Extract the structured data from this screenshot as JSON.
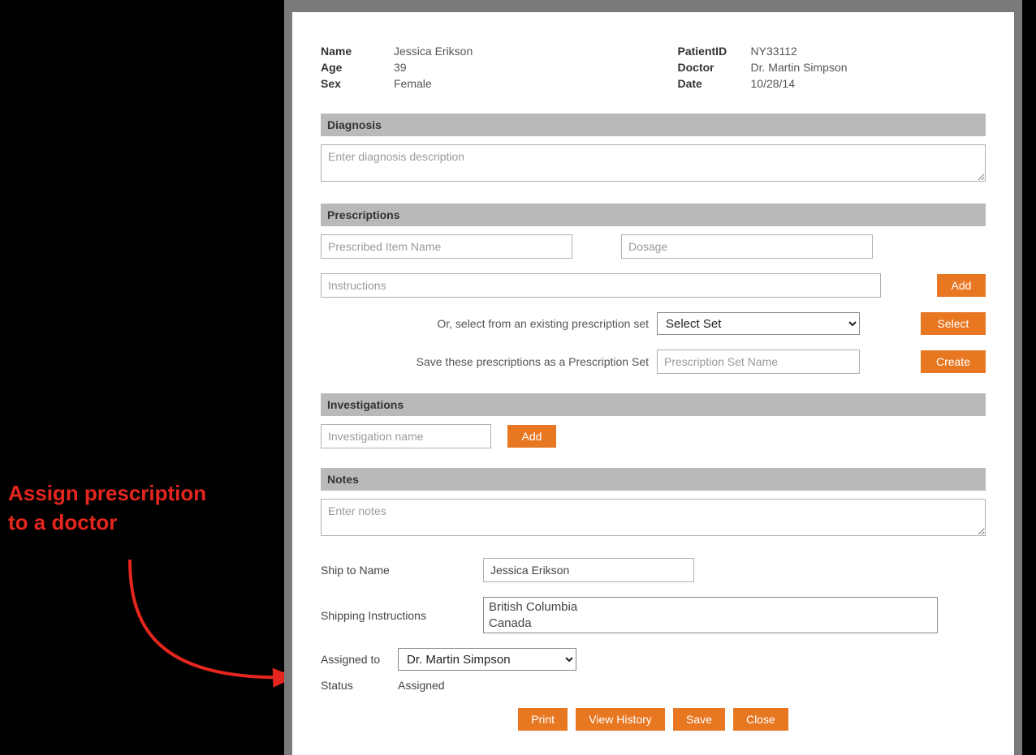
{
  "annotation": {
    "line1": "Assign prescription",
    "line2": "to a doctor"
  },
  "patient": {
    "name_label": "Name",
    "name": "Jessica Erikson",
    "age_label": "Age",
    "age": "39",
    "sex_label": "Sex",
    "sex": "Female",
    "id_label": "PatientID",
    "id": "NY33112",
    "doctor_label": "Doctor",
    "doctor": "Dr. Martin Simpson",
    "date_label": "Date",
    "date": "10/28/14"
  },
  "diagnosis": {
    "header": "Diagnosis",
    "placeholder": "Enter diagnosis description"
  },
  "prescriptions": {
    "header": "Prescriptions",
    "item_placeholder": "Prescribed Item Name",
    "dosage_placeholder": "Dosage",
    "instructions_placeholder": "Instructions",
    "add_btn": "Add",
    "select_label": "Or, select from an existing prescription set",
    "select_placeholder": "Select Set",
    "select_btn": "Select",
    "save_label": "Save these prescriptions as a Prescription Set",
    "save_placeholder": "Prescription Set Name",
    "create_btn": "Create"
  },
  "investigations": {
    "header": "Investigations",
    "placeholder": "Investigation name",
    "add_btn": "Add"
  },
  "notes": {
    "header": "Notes",
    "placeholder": "Enter notes"
  },
  "shipping": {
    "name_label": "Ship to Name",
    "name_value": "Jessica Erikson",
    "instructions_label": "Shipping Instructions",
    "instructions_line1": "British Columbia",
    "instructions_line2": "Canada"
  },
  "assignment": {
    "assigned_label": "Assigned to",
    "assigned_value": "Dr. Martin Simpson",
    "status_label": "Status",
    "status_value": "Assigned"
  },
  "footer": {
    "print": "Print",
    "history": "View History",
    "save": "Save",
    "close": "Close"
  }
}
